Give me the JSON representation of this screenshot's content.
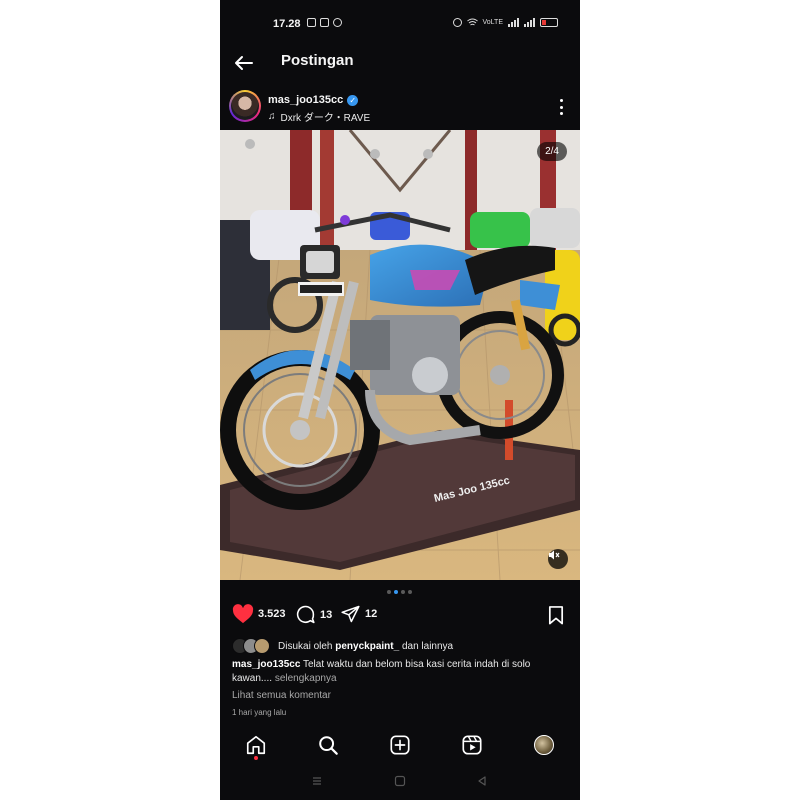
{
  "status_bar": {
    "time": "17.28",
    "left_icons": [
      "app-notif-icon",
      "instagram-notif-icon",
      "whatsapp-notif-icon"
    ],
    "right_icons": [
      "alarm-icon",
      "wifi-icon",
      "volte-icon",
      "signal-icon",
      "signal-icon",
      "battery-icon"
    ],
    "volte": "VoLTE"
  },
  "header": {
    "title": "Postingan",
    "back_icon": "arrow-left-icon"
  },
  "post": {
    "username": "mas_joo135cc",
    "verified": true,
    "music": "Dxrk ダーク・RAVE",
    "image_counter": "2/4",
    "image_description_icons": [
      "mute-icon"
    ],
    "carousel": {
      "count": 4,
      "active": 1
    }
  },
  "actions": {
    "likes": "3.523",
    "comments": "13",
    "shares": "12",
    "like_color": "#ff3040"
  },
  "liked_by": {
    "prefix": "Disukai oleh",
    "user": "penyckpaint_",
    "suffix": "dan lainnya"
  },
  "caption": {
    "username": "mas_joo135cc",
    "text": "Telat waktu dan belom bisa kasi cerita indah di solo kawan....",
    "more": "selengkapnya"
  },
  "view_comments": "Lihat semua komentar",
  "timestamp": "1 hari yang lalu",
  "bottom_nav": [
    "home-icon",
    "search-icon",
    "create-icon",
    "reels-icon",
    "profile-avatar"
  ],
  "colors": {
    "background": "#0b0b0d",
    "accent": "#3797f0",
    "like": "#ff3040"
  }
}
